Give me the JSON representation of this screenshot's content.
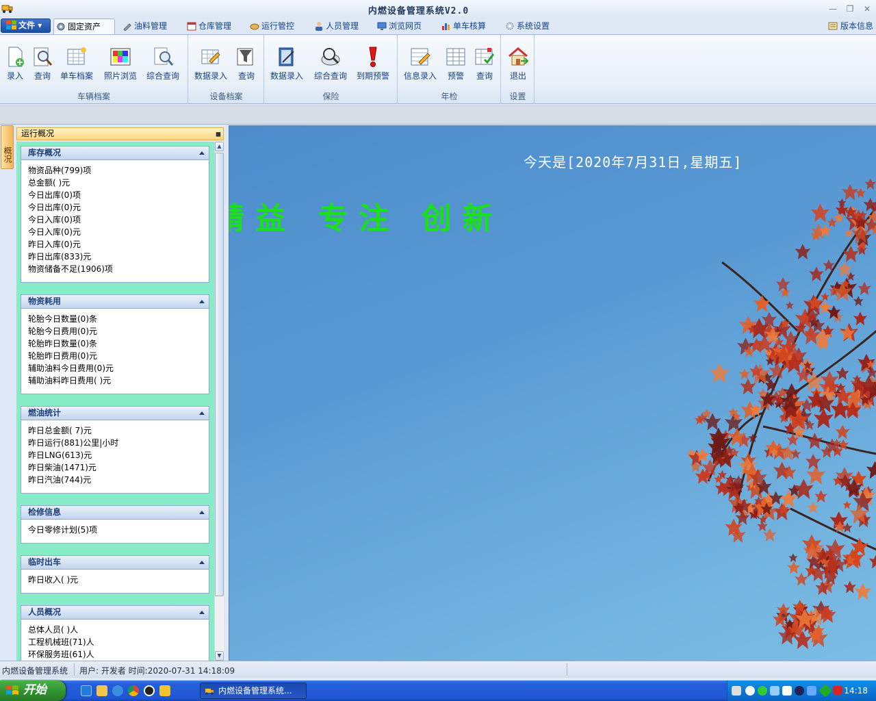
{
  "window": {
    "title": "内燃设备管理系统V2.0"
  },
  "file_menu": {
    "label": "文件"
  },
  "tabs": [
    {
      "label": "固定资产",
      "active": true
    },
    {
      "label": "油料管理"
    },
    {
      "label": "仓库管理"
    },
    {
      "label": "运行管控"
    },
    {
      "label": "人员管理"
    },
    {
      "label": "浏览网页"
    },
    {
      "label": "单车核算"
    },
    {
      "label": "系统设置"
    }
  ],
  "version_label": "版本信息",
  "ribbon": {
    "groups": [
      {
        "caption": "车辆档案",
        "buttons": [
          "录入",
          "查询",
          "单车档案",
          "照片浏览",
          "综合查询"
        ]
      },
      {
        "caption": "设备档案",
        "buttons": [
          "数据录入",
          "查询"
        ]
      },
      {
        "caption": "保险",
        "buttons": [
          "数据录入",
          "综合查询",
          "到期预警"
        ]
      },
      {
        "caption": "年检",
        "buttons": [
          "信息录入",
          "预警",
          "查询"
        ]
      },
      {
        "caption": "设置",
        "buttons": [
          "退出"
        ]
      }
    ]
  },
  "dock_tab": "概况",
  "panel": {
    "title": "运行概况",
    "sections": [
      {
        "title": "库存概况",
        "rows": [
          "物资品种(799)项",
          "总金额(        )元",
          "今日出库(0)项",
          "今日出库(0)元",
          "今日入库(0)项",
          "今日入库(0)元",
          "昨日入库(0)元",
          "昨日出库(833)元",
          "物资储备不足(1906)项"
        ]
      },
      {
        "title": "物资耗用",
        "rows": [
          "轮胎今日数量(0)条",
          "轮胎今日费用(0)元",
          "轮胎昨日数量(0)条",
          "轮胎昨日费用(0)元",
          "辅助油料今日费用(0)元",
          "辅助油料昨日费用(    )元"
        ]
      },
      {
        "title": "燃油统计",
        "rows": [
          "昨日总金额(     7)元",
          "昨日运行(881)公里|小时",
          "昨日LNG(613)元",
          "昨日柴油(1471)元",
          "昨日汽油(744)元"
        ]
      },
      {
        "title": "检修信息",
        "rows": [
          "今日零修计划(5)项"
        ]
      },
      {
        "title": "临时出车",
        "rows": [
          "昨日收入(     )元"
        ]
      },
      {
        "title": "人员概况",
        "rows": [
          "总体人员(    )人",
          "工程机械班(71)人",
          "环保服务班(61)人"
        ]
      }
    ]
  },
  "main": {
    "date_text": "今天是[2020年7月31日,星期五]",
    "slogan": "精益 专注 创新",
    "slogan_color": "#19e019"
  },
  "status": {
    "app": "内燃设备管理系统",
    "user_time": "用户: 开发者 时间:2020-07-31 14:18:09"
  },
  "taskbar": {
    "start": "开始",
    "task_item": "内燃设备管理系统...",
    "clock": "14:18"
  }
}
